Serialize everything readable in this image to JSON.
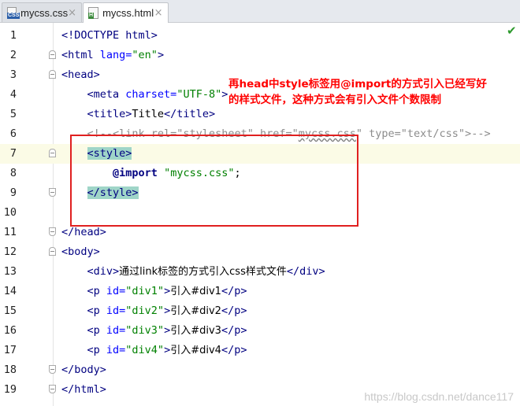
{
  "tabs": [
    {
      "name": "mycss.css",
      "icon": "css-file-icon",
      "icon_label": "CSS",
      "active": false
    },
    {
      "name": "mycss.html",
      "icon": "html-file-icon",
      "icon_label": "H",
      "active": true
    }
  ],
  "close_glyph": "×",
  "status_check": "✔",
  "annotation": "再head中style标签用@import的方式引入已经写好的样式文件，这种方式会有引入文件个数限制",
  "watermark": "https://blog.csdn.net/dance117",
  "lines": [
    {
      "n": "1",
      "tokens": [
        {
          "t": "<!DOCTYPE html>",
          "c": "tag"
        }
      ]
    },
    {
      "n": "2",
      "tokens": [
        {
          "t": "<",
          "c": "tag"
        },
        {
          "t": "html ",
          "c": "tag"
        },
        {
          "t": "lang=",
          "c": "attr"
        },
        {
          "t": "\"en\"",
          "c": "val"
        },
        {
          "t": ">",
          "c": "tag"
        }
      ]
    },
    {
      "n": "3",
      "tokens": [
        {
          "t": "<head>",
          "c": "tag"
        }
      ]
    },
    {
      "n": "4",
      "tokens": [
        {
          "t": "    <meta ",
          "c": "tag"
        },
        {
          "t": "charset=",
          "c": "attr"
        },
        {
          "t": "\"UTF-8\"",
          "c": "val"
        },
        {
          "t": ">",
          "c": "tag"
        }
      ]
    },
    {
      "n": "5",
      "tokens": [
        {
          "t": "    <title>",
          "c": "tag"
        },
        {
          "t": "Title",
          "c": "txt"
        },
        {
          "t": "</title>",
          "c": "tag"
        }
      ]
    },
    {
      "n": "6",
      "tokens": [
        {
          "t": "    <!--<link rel=\"stylesheet\" href=\"",
          "c": "cmt"
        },
        {
          "t": "mycss.css",
          "c": "cmt wavy"
        },
        {
          "t": "\" type=\"text/css\">-->",
          "c": "cmt"
        }
      ]
    },
    {
      "n": "7",
      "tokens": [
        {
          "t": "    ",
          "c": "txt"
        },
        {
          "t": "<style>",
          "c": "tag hl"
        }
      ]
    },
    {
      "n": "8",
      "tokens": [
        {
          "t": "        ",
          "c": "txt"
        },
        {
          "t": "@import",
          "c": "kw"
        },
        {
          "t": " ",
          "c": "txt"
        },
        {
          "t": "\"mycss.css\"",
          "c": "str"
        },
        {
          "t": ";",
          "c": "txt"
        }
      ]
    },
    {
      "n": "9",
      "tokens": [
        {
          "t": "    ",
          "c": "txt"
        },
        {
          "t": "</style>",
          "c": "tag hl"
        }
      ]
    },
    {
      "n": "10",
      "tokens": []
    },
    {
      "n": "11",
      "tokens": [
        {
          "t": "</head>",
          "c": "tag"
        }
      ]
    },
    {
      "n": "12",
      "tokens": [
        {
          "t": "<body>",
          "c": "tag"
        }
      ]
    },
    {
      "n": "13",
      "tokens": [
        {
          "t": "    <div>",
          "c": "tag"
        },
        {
          "t": "通过link标签的方式引入css样式文件",
          "c": "txt cn"
        },
        {
          "t": "</div>",
          "c": "tag"
        }
      ]
    },
    {
      "n": "14",
      "tokens": [
        {
          "t": "    <p ",
          "c": "tag"
        },
        {
          "t": "id=",
          "c": "attr"
        },
        {
          "t": "\"div1\"",
          "c": "val"
        },
        {
          "t": ">",
          "c": "tag"
        },
        {
          "t": "引入#div1",
          "c": "txt cn"
        },
        {
          "t": "</p>",
          "c": "tag"
        }
      ]
    },
    {
      "n": "15",
      "tokens": [
        {
          "t": "    <p ",
          "c": "tag"
        },
        {
          "t": "id=",
          "c": "attr"
        },
        {
          "t": "\"div2\"",
          "c": "val"
        },
        {
          "t": ">",
          "c": "tag"
        },
        {
          "t": "引入#div2",
          "c": "txt cn"
        },
        {
          "t": "</p>",
          "c": "tag"
        }
      ]
    },
    {
      "n": "16",
      "tokens": [
        {
          "t": "    <p ",
          "c": "tag"
        },
        {
          "t": "id=",
          "c": "attr"
        },
        {
          "t": "\"div3\"",
          "c": "val"
        },
        {
          "t": ">",
          "c": "tag"
        },
        {
          "t": "引入#div3",
          "c": "txt cn"
        },
        {
          "t": "</p>",
          "c": "tag"
        }
      ]
    },
    {
      "n": "17",
      "tokens": [
        {
          "t": "    <p ",
          "c": "tag"
        },
        {
          "t": "id=",
          "c": "attr"
        },
        {
          "t": "\"div4\"",
          "c": "val"
        },
        {
          "t": ">",
          "c": "tag"
        },
        {
          "t": "引入#div4",
          "c": "txt cn"
        },
        {
          "t": "</p>",
          "c": "tag"
        }
      ]
    },
    {
      "n": "18",
      "tokens": [
        {
          "t": "</body>",
          "c": "tag"
        }
      ]
    },
    {
      "n": "19",
      "tokens": [
        {
          "t": "</html>",
          "c": "tag"
        }
      ]
    }
  ]
}
